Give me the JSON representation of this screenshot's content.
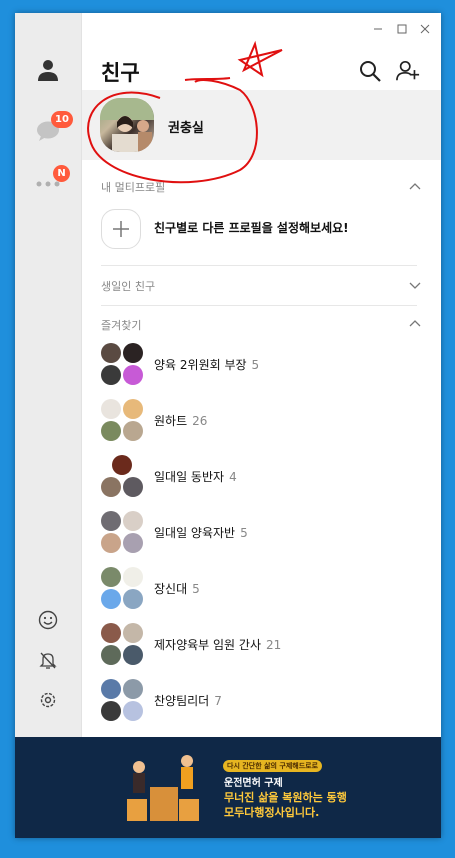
{
  "window": {
    "minimize_icon": "minimize-icon",
    "maximize_icon": "maximize-icon",
    "close_icon": "close-icon"
  },
  "sidebar": {
    "friends_icon": "person-icon",
    "chats_badge": "10",
    "more_badge": "N",
    "emoticon_icon": "smiley-icon",
    "notification_icon": "bell-off-icon",
    "settings_icon": "gear-icon"
  },
  "header": {
    "title": "친구",
    "search_icon": "search-icon",
    "add_friend_icon": "add-friend-icon"
  },
  "my_profile": {
    "name": "권충실"
  },
  "multi_profile": {
    "section_label": "내 멀티프로필",
    "add_text": "친구별로 다른 프로필을 설정해보세요!"
  },
  "birthday": {
    "section_label": "생일인 친구"
  },
  "favorites": {
    "section_label": "즐겨찾기",
    "items": [
      {
        "name": "양육 2위원회 부장",
        "count": "5"
      },
      {
        "name": "원하트",
        "count": "26"
      },
      {
        "name": "일대일 동반자",
        "count": "4"
      },
      {
        "name": "일대일 양육자반",
        "count": "5"
      },
      {
        "name": "장신대",
        "count": "5"
      },
      {
        "name": "제자양육부 임원 간사",
        "count": "21"
      },
      {
        "name": "찬양팀리더",
        "count": "7"
      }
    ]
  },
  "ad": {
    "tag": "다시 간단한 삶의 구제해드로로",
    "line1": "운전면허 구제",
    "line2": "무너진 삶을 복원하는 동행",
    "line3": "모두다행정사입니다."
  },
  "colors": {
    "badge": "#ff5a3c",
    "sidebar_bg": "#ececec",
    "ad_bg": "#0f2847",
    "ad_accent": "#ffc93b",
    "annotation": "#e01010"
  }
}
